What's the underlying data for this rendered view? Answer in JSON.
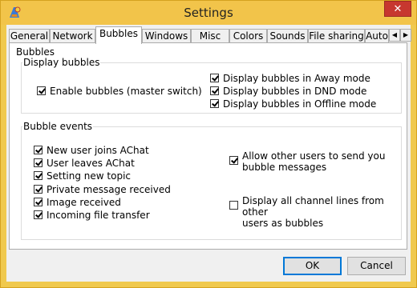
{
  "window": {
    "title": "Settings",
    "close_label": "✕"
  },
  "tabs": [
    {
      "label": "General"
    },
    {
      "label": "Network"
    },
    {
      "label": "Bubbles"
    },
    {
      "label": "Windows"
    },
    {
      "label": "Misc"
    },
    {
      "label": "Colors"
    },
    {
      "label": "Sounds"
    },
    {
      "label": "File sharing"
    },
    {
      "label": "Auto"
    }
  ],
  "active_tab": "Bubbles",
  "tab_scroll": {
    "left": "◀",
    "right": "▶"
  },
  "panel": {
    "title": "Bubbles",
    "display_group": {
      "title": "Display bubbles",
      "master": {
        "label": "Enable bubbles (master switch)",
        "checked": true
      },
      "modes": [
        {
          "label": "Display bubbles in Away mode",
          "checked": true
        },
        {
          "label": "Display bubbles in DND mode",
          "checked": true
        },
        {
          "label": "Display bubbles in Offline mode",
          "checked": true
        }
      ]
    },
    "events_group": {
      "title": "Bubble events",
      "events": [
        {
          "label": "New user joins AChat",
          "checked": true
        },
        {
          "label": "User leaves AChat",
          "checked": true
        },
        {
          "label": "Setting new topic",
          "checked": true
        },
        {
          "label": "Private message received",
          "checked": true
        },
        {
          "label": "Image received",
          "checked": true
        },
        {
          "label": "Incoming file transfer",
          "checked": true
        }
      ],
      "allow_others": {
        "line1": "Allow other users to send you",
        "line2": "bubble messages",
        "checked": true
      },
      "channel_lines": {
        "line1": "Display all channel lines from other",
        "line2": "users as bubbles",
        "checked": false
      }
    }
  },
  "buttons": {
    "ok": "OK",
    "cancel": "Cancel"
  }
}
